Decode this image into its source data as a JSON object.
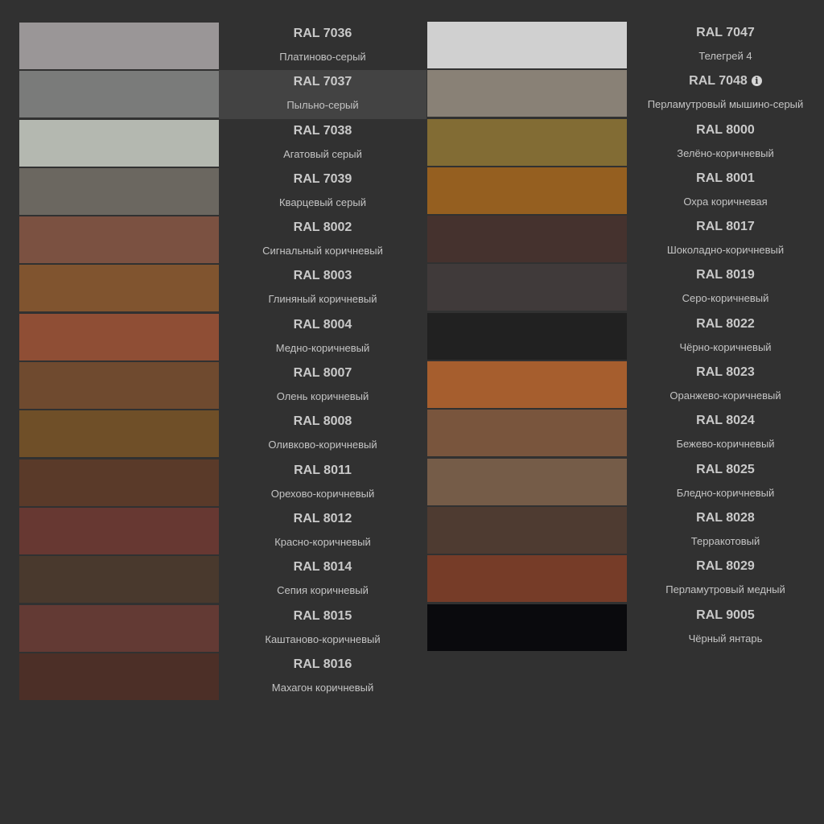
{
  "left_column": [
    {
      "code": "RAL 7036",
      "name": "Платиново-серый",
      "color": "#9a9697"
    },
    {
      "code": "RAL 7037",
      "name": "Пыльно-серый",
      "color": "#7a7b7a",
      "highlighted": true
    },
    {
      "code": "RAL 7038",
      "name": "Агатовый серый",
      "color": "#b4b8b0"
    },
    {
      "code": "RAL 7039",
      "name": "Кварцевый серый",
      "color": "#6b6760"
    },
    {
      "code": "RAL 8002",
      "name": "Сигнальный коричневый",
      "color": "#7b5141"
    },
    {
      "code": "RAL 8003",
      "name": "Глиняный коричневый",
      "color": "#80542f"
    },
    {
      "code": "RAL 8004",
      "name": "Медно-коричневый",
      "color": "#8f4e35"
    },
    {
      "code": "RAL 8007",
      "name": "Олень коричневый",
      "color": "#6f4a2f"
    },
    {
      "code": "RAL 8008",
      "name": "Оливково-коричневый",
      "color": "#6f4f28"
    },
    {
      "code": "RAL 8011",
      "name": "Орехово-коричневый",
      "color": "#5a3a29"
    },
    {
      "code": "RAL 8012",
      "name": "Красно-коричневый",
      "color": "#673832"
    },
    {
      "code": "RAL 8014",
      "name": "Сепия коричневый",
      "color": "#49392d"
    },
    {
      "code": "RAL 8015",
      "name": "Каштаново-коричневый",
      "color": "#633a34"
    },
    {
      "code": "RAL 8016",
      "name": "Махагон коричневый",
      "color": "#4c2f27"
    }
  ],
  "right_column": [
    {
      "code": "RAL 7047",
      "name": "Телегрей 4",
      "color": "#d0d0d0"
    },
    {
      "code": "RAL 7048",
      "name": "Перламутровый мышино-серый",
      "color": "#898176",
      "info_icon": "info-icon",
      "info_glyph": "i"
    },
    {
      "code": "RAL 8000",
      "name": "Зелёно-коричневый",
      "color": "#826c34"
    },
    {
      "code": "RAL 8001",
      "name": "Охра коричневая",
      "color": "#955f20"
    },
    {
      "code": "RAL 8017",
      "name": "Шоколадно-коричневый",
      "color": "#45322e"
    },
    {
      "code": "RAL 8019",
      "name": "Серо-коричневый",
      "color": "#403a3a"
    },
    {
      "code": "RAL 8022",
      "name": "Чёрно-коричневый",
      "color": "#212121"
    },
    {
      "code": "RAL 8023",
      "name": "Оранжево-коричневый",
      "color": "#a65e2e"
    },
    {
      "code": "RAL 8024",
      "name": "Бежево-коричневый",
      "color": "#79553d"
    },
    {
      "code": "RAL 8025",
      "name": "Бледно-коричневый",
      "color": "#755c48"
    },
    {
      "code": "RAL 8028",
      "name": "Терракотовый",
      "color": "#4e3b31"
    },
    {
      "code": "RAL 8029",
      "name": "Перламутровый медный",
      "color": "#763c28"
    },
    {
      "code": "RAL 9005",
      "name": "Чёрный янтарь",
      "color": "#0a0a0d"
    }
  ],
  "colors": {
    "background": "#313131",
    "highlight": "#434343",
    "text": "#c8c8c8"
  }
}
